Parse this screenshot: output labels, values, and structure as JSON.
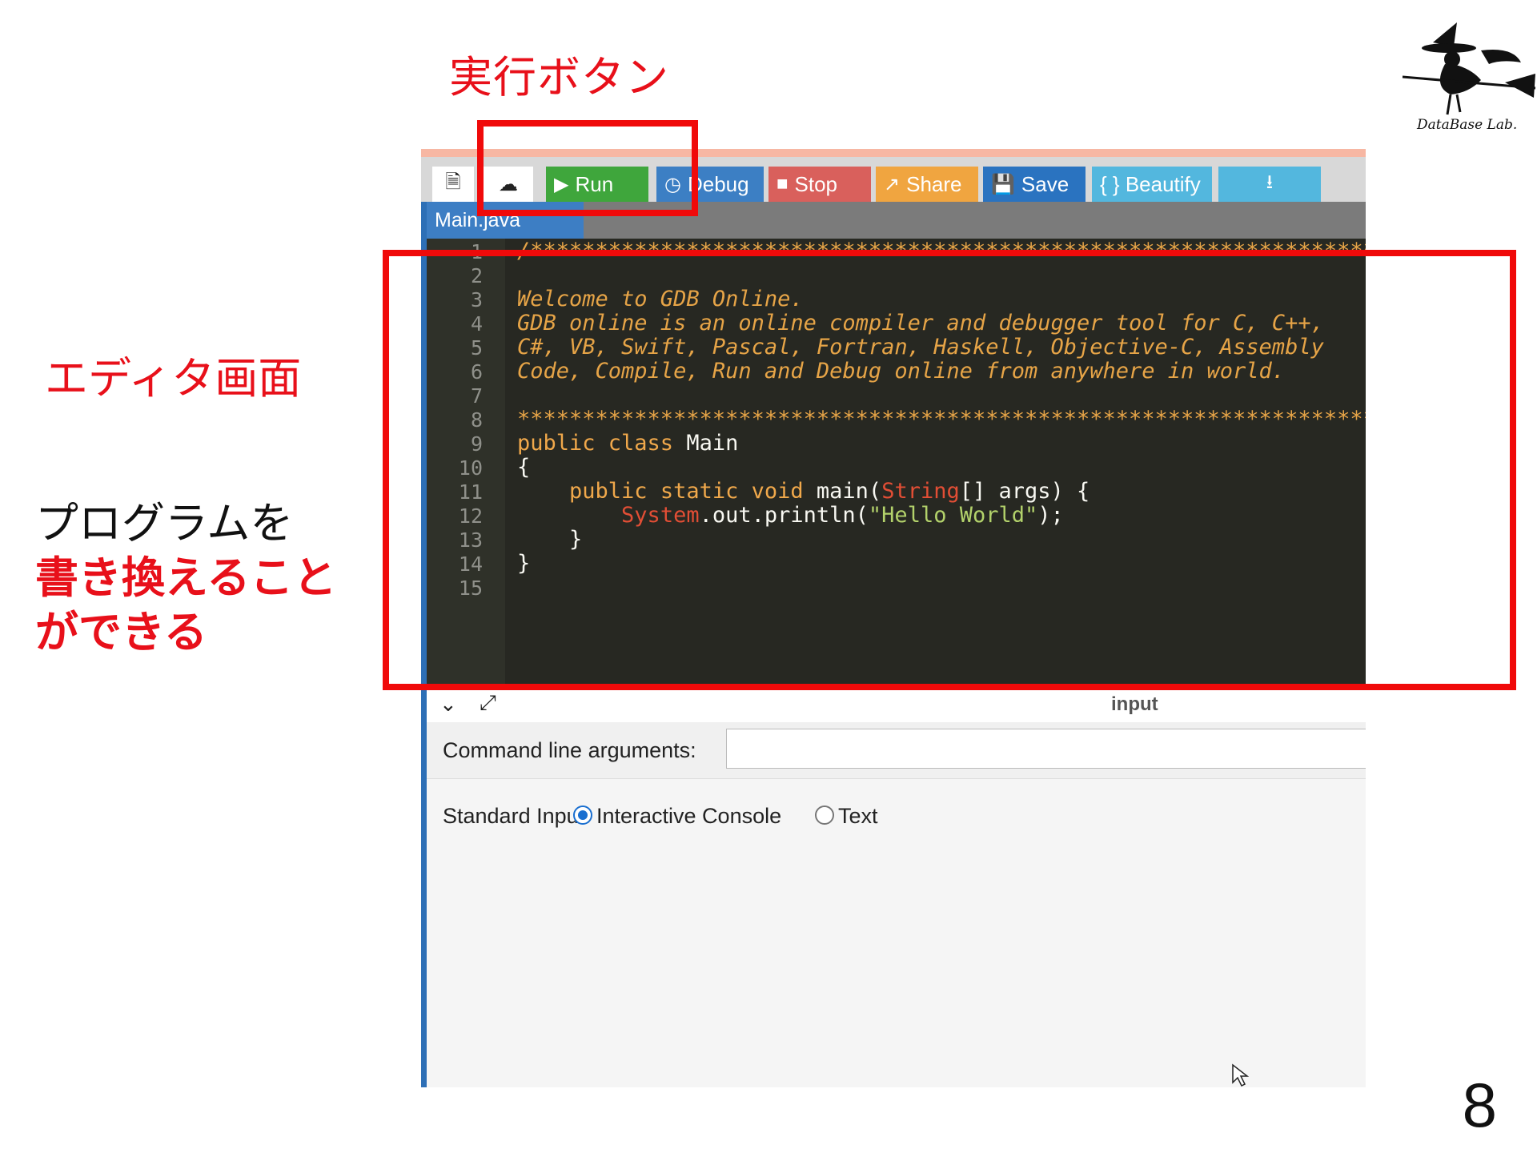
{
  "annotations": {
    "run_button_label": "実行ボタン",
    "editor_label": "エディタ画面",
    "desc_line1": "プログラムを",
    "desc_line2": "書き換えること",
    "desc_line3": "ができる"
  },
  "page_number": "8",
  "logo": {
    "text": "DataBase Lab."
  },
  "toolbar": {
    "new_icon": "file-icon",
    "upload_icon": "cloud-upload-icon",
    "run": "Run",
    "debug": "Debug",
    "stop": "Stop",
    "share": "Share",
    "save": "Save",
    "beautify": "{ } Beautify",
    "download_icon": "download-icon"
  },
  "tabs": [
    {
      "label": "Main.java"
    }
  ],
  "editor": {
    "line_numbers": [
      "1",
      "2",
      "3",
      "4",
      "5",
      "6",
      "7",
      "8",
      "9",
      "10",
      "11",
      "12",
      "13",
      "14",
      "15"
    ],
    "line1": "/******************************************************************************",
    "line3": "Welcome to GDB Online.",
    "line4": "GDB online is an online compiler and debugger tool for C, C++,",
    "line5": "C#, VB, Swift, Pascal, Fortran, Haskell, Objective-C, Assembly",
    "line6": "Code, Compile, Run and Debug online from anywhere in world.",
    "line8": "*******************************************************************************/",
    "line9_kw": "public class",
    "line9_name": "Main",
    "line10": "{",
    "line11_kw": "public static void",
    "line11_fn": "main(",
    "line11_type": "String",
    "line11_rest": "[] args) {",
    "line12_type": "System",
    "line12_mid": ".out.println(",
    "line12_str": "\"Hello World\"",
    "line12_end": ");",
    "line13": "}",
    "line14": "}"
  },
  "io": {
    "panel_label": "input",
    "args_label": "Command line arguments:",
    "args_value": "",
    "stdin_label": "Standard Input:",
    "option_console": "Interactive Console",
    "option_text": "Text",
    "selected": "Interactive Console"
  },
  "colors": {
    "highlight": "#f00a0a",
    "run_button": "#3fa63c",
    "annotation_red": "#e8101a"
  }
}
